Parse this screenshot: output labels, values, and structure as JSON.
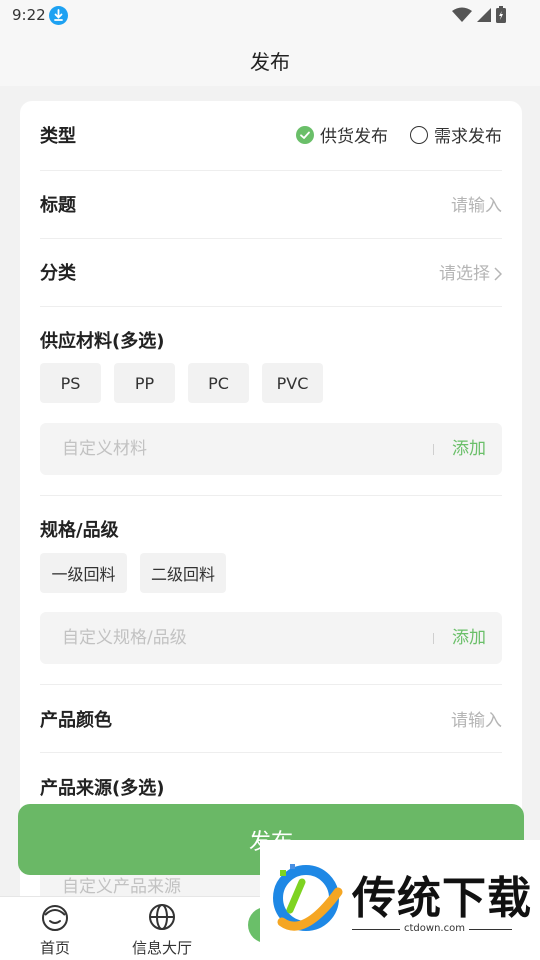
{
  "status": {
    "time": "9:22"
  },
  "nav": {
    "title": "发布"
  },
  "form": {
    "type": {
      "label": "类型",
      "option_supply": "供货发布",
      "option_demand": "需求发布",
      "selected": "供货发布"
    },
    "title": {
      "label": "标题",
      "placeholder": "请输入"
    },
    "category": {
      "label": "分类",
      "placeholder": "请选择"
    },
    "materials": {
      "label": "供应材料(多选)",
      "chips": [
        "PS",
        "PP",
        "PC",
        "PVC"
      ],
      "custom_placeholder": "自定义材料",
      "add_label": "添加"
    },
    "spec": {
      "label": "规格/品级",
      "chips": [
        "一级回料",
        "二级回料"
      ],
      "custom_placeholder": "自定义规格/品级",
      "add_label": "添加"
    },
    "color": {
      "label": "产品颜色",
      "placeholder": "请输入"
    },
    "source": {
      "label": "产品来源(多选)",
      "custom_placeholder": "自定义产品来源"
    }
  },
  "publish_button": {
    "label": "发布"
  },
  "tabbar": {
    "tabs": [
      {
        "label": "首页"
      },
      {
        "label": "信息大厅"
      }
    ]
  },
  "watermark": {
    "text": "传统下载",
    "url": "ctdown.com"
  },
  "colors": {
    "accent": "#6abf69",
    "button": "#6ab866"
  }
}
